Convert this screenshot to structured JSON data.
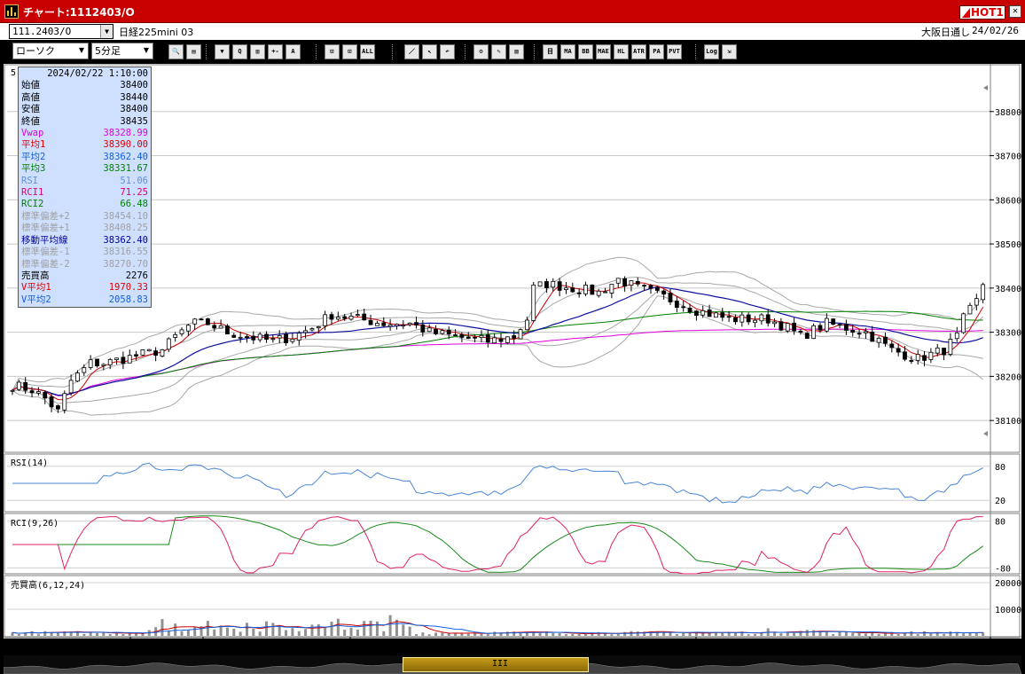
{
  "window": {
    "title": "チャート:1112403/O",
    "hot_label": "HOT1",
    "close_label": "✕"
  },
  "infobar": {
    "symbol": "111.2403/O",
    "instrument": "日経225mini 03",
    "market": "大阪日通し",
    "date": "24/02/26"
  },
  "toolbar": {
    "chart_type": "ローソク",
    "interval": "5分足",
    "buttons": [
      {
        "name": "zoom",
        "label": "🔍"
      },
      {
        "name": "layout",
        "label": "▤"
      },
      {
        "name": "t1",
        "label": "▼"
      },
      {
        "name": "t2",
        "label": "Q"
      },
      {
        "name": "t3",
        "label": "▥"
      },
      {
        "name": "t4",
        "label": "+-"
      },
      {
        "name": "t5",
        "label": "A"
      },
      {
        "name": "candle-a",
        "label": "⊡"
      },
      {
        "name": "candle-b",
        "label": "⊡"
      },
      {
        "name": "all",
        "label": "ALL"
      },
      {
        "name": "draw-line",
        "label": "／"
      },
      {
        "name": "cursor",
        "label": "↖"
      },
      {
        "name": "undo",
        "label": "↶"
      },
      {
        "name": "settings",
        "label": "⚙"
      },
      {
        "name": "pen",
        "label": "✎"
      },
      {
        "name": "color",
        "label": "▧"
      },
      {
        "name": "ich",
        "label": "目"
      },
      {
        "name": "ma",
        "label": "MA"
      },
      {
        "name": "bb",
        "label": "BB"
      },
      {
        "name": "mae",
        "label": "MAE"
      },
      {
        "name": "hl",
        "label": "HL"
      },
      {
        "name": "atr",
        "label": "ATR"
      },
      {
        "name": "para",
        "label": "PA"
      },
      {
        "name": "pvt",
        "label": "PVT"
      },
      {
        "name": "log",
        "label": "Log"
      },
      {
        "name": "export",
        "label": "⇲"
      }
    ]
  },
  "data_panel": {
    "tab_label": "5",
    "datetime": "2024/02/22 1:10:00",
    "rows": [
      {
        "label": "始値",
        "value": "38400",
        "color": "#000000"
      },
      {
        "label": "高値",
        "value": "38440",
        "color": "#000000"
      },
      {
        "label": "安値",
        "value": "38400",
        "color": "#000000"
      },
      {
        "label": "終値",
        "value": "38435",
        "color": "#000000"
      },
      {
        "label": "Vwap",
        "value": "38328.99",
        "color": "#e000e0"
      },
      {
        "label": "平均1",
        "value": "38390.00",
        "color": "#e00000"
      },
      {
        "label": "平均2",
        "value": "38362.40",
        "color": "#1060e0"
      },
      {
        "label": "平均3",
        "value": "38331.67",
        "color": "#008000"
      },
      {
        "label": "RSI",
        "value": "51.06",
        "color": "#6090e0"
      },
      {
        "label": "RCI1",
        "value": "71.25",
        "color": "#e00070"
      },
      {
        "label": "RCI2",
        "value": "66.48",
        "color": "#008000"
      },
      {
        "label": "標準偏差+2",
        "value": "38454.10",
        "color": "#a0a0a0"
      },
      {
        "label": "標準偏差+1",
        "value": "38408.25",
        "color": "#a0a0a0"
      },
      {
        "label": "移動平均線",
        "value": "38362.40",
        "color": "#0000a0"
      },
      {
        "label": "標準偏差-1",
        "value": "38316.55",
        "color": "#a0a0a0"
      },
      {
        "label": "標準偏差-2",
        "value": "38270.70",
        "color": "#a0a0a0"
      },
      {
        "label": "売買高",
        "value": "2276",
        "color": "#000000"
      },
      {
        "label": "V平均1",
        "value": "1970.33",
        "color": "#e00000"
      },
      {
        "label": "V平均2",
        "value": "2058.83",
        "color": "#1060e0"
      }
    ]
  },
  "chart_data": [
    {
      "type": "candlestick",
      "title": "",
      "y_ticks": [
        38100,
        38200,
        38300,
        38400,
        38500,
        38600,
        38700,
        38800
      ],
      "ylim": [
        38030,
        38900
      ],
      "x_tick_labels": [
        "14",
        "21/16:30",
        "19",
        "22",
        "1",
        "4",
        "22/8:45"
      ],
      "n_bars": 150,
      "overlays": [
        "Vwap",
        "平均1",
        "平均2",
        "平均3",
        "標準偏差+2",
        "標準偏差+1",
        "移動平均線",
        "標準偏差-1",
        "標準偏差-2"
      ],
      "price_path": [
        [
          0,
          38180
        ],
        [
          6,
          38170
        ],
        [
          10,
          38150
        ],
        [
          14,
          38120
        ],
        [
          18,
          38190
        ],
        [
          24,
          38230
        ],
        [
          28,
          38230
        ],
        [
          34,
          38240
        ],
        [
          40,
          38250
        ],
        [
          46,
          38260
        ],
        [
          50,
          38290
        ],
        [
          55,
          38320
        ],
        [
          60,
          38320
        ],
        [
          66,
          38300
        ],
        [
          72,
          38290
        ],
        [
          80,
          38280
        ],
        [
          86,
          38290
        ],
        [
          92,
          38310
        ],
        [
          98,
          38340
        ],
        [
          106,
          38330
        ],
        [
          114,
          38320
        ],
        [
          122,
          38320
        ],
        [
          128,
          38300
        ],
        [
          136,
          38290
        ],
        [
          146,
          38280
        ],
        [
          154,
          38290
        ],
        [
          158,
          38330
        ],
        [
          160,
          38400
        ],
        [
          164,
          38410
        ],
        [
          172,
          38400
        ],
        [
          180,
          38390
        ],
        [
          186,
          38420
        ],
        [
          192,
          38400
        ],
        [
          200,
          38380
        ],
        [
          210,
          38350
        ],
        [
          220,
          38330
        ],
        [
          232,
          38330
        ],
        [
          238,
          38310
        ],
        [
          242,
          38290
        ],
        [
          250,
          38320
        ],
        [
          262,
          38300
        ],
        [
          270,
          38260
        ],
        [
          278,
          38240
        ],
        [
          286,
          38260
        ],
        [
          290,
          38290
        ],
        [
          292,
          38330
        ],
        [
          296,
          38370
        ],
        [
          299,
          38430
        ]
      ]
    },
    {
      "type": "line",
      "title": "RSI(14)",
      "series": [
        {
          "name": "RSI",
          "color": "#4a86d8"
        }
      ],
      "y_ticks": [
        20,
        80
      ],
      "ylim": [
        0,
        100
      ]
    },
    {
      "type": "line",
      "title": "RCI(9,26)",
      "series": [
        {
          "name": "RCI1",
          "color": "#e0206a"
        },
        {
          "name": "RCI2",
          "color": "#1a8a1a"
        }
      ],
      "y_ticks": [
        -80,
        80
      ],
      "ylim": [
        -100,
        100
      ]
    },
    {
      "type": "bar",
      "title": "売買高(6,12,24)",
      "y_ticks": [
        10000,
        20000
      ],
      "ylim": [
        0,
        22000
      ]
    }
  ],
  "navigator": {
    "thumb_label": "III"
  }
}
